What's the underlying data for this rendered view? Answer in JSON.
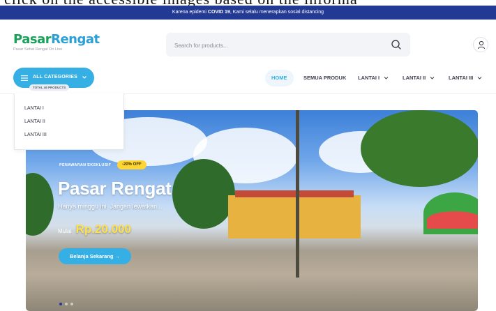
{
  "document_strip": {
    "text": "click on the accessible images based on the informa"
  },
  "announcement": {
    "prefix": "Karena epidemi ",
    "bold": "COVID 19",
    "suffix": ", Kami selalu menerapkan sosial distancing"
  },
  "brand": {
    "name_part1": "Pasar",
    "name_part2": "Rengat",
    "tagline": "Pasar Sehat Rengat On Line",
    "colors": {
      "green": "#1aa05a",
      "blue": "#2b9fd6"
    }
  },
  "search": {
    "placeholder": "Search for products...",
    "value": ""
  },
  "categories": {
    "label": "ALL CATEGORIES",
    "total": "TOTAL 46 PRODUCTS",
    "options": [
      "LANTAI I",
      "LANTAI II",
      "LANTAI III"
    ]
  },
  "nav": {
    "items": [
      "HOME",
      "SEMUA PRODUK",
      "LANTAI I",
      "LANTAI II",
      "LANTAI III"
    ],
    "active": "HOME"
  },
  "hero": {
    "eyebrow": "PENAWARAN EKSKLUSIF",
    "badge": "-20% OFF",
    "title": "Pasar Rengat",
    "subtitle": "Hanya minggu ini. Jangan lewatkan...",
    "price_prefix": "Mulai",
    "price": "Rp.20.000",
    "cta": "Belanja Sekarang →",
    "slide_current": 1,
    "slide_count": 3
  },
  "colors": {
    "topbar": "#233a95",
    "accent": "#35afe4",
    "badge": "#ffd533",
    "price": "#ffe14a"
  },
  "icons": [
    "menu-icon",
    "chevron-down-icon",
    "search-icon",
    "user-icon",
    "arrow-right-icon"
  ]
}
